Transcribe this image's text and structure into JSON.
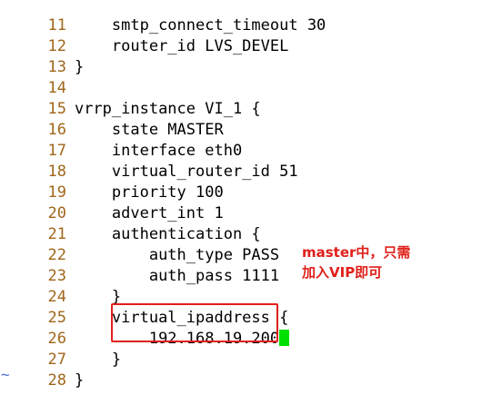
{
  "editor": {
    "lines": [
      {
        "num": "11",
        "text": "    smtp_connect_timeout 30"
      },
      {
        "num": "12",
        "text": "    router_id LVS_DEVEL"
      },
      {
        "num": "13",
        "text": "}"
      },
      {
        "num": "14",
        "text": ""
      },
      {
        "num": "15",
        "text": "vrrp_instance VI_1 {"
      },
      {
        "num": "16",
        "text": "    state MASTER"
      },
      {
        "num": "17",
        "text": "    interface eth0"
      },
      {
        "num": "18",
        "text": "    virtual_router_id 51"
      },
      {
        "num": "19",
        "text": "    priority 100"
      },
      {
        "num": "20",
        "text": "    advert_int 1"
      },
      {
        "num": "21",
        "text": "    authentication {"
      },
      {
        "num": "22",
        "text": "        auth_type PASS"
      },
      {
        "num": "23",
        "text": "        auth_pass 1111"
      },
      {
        "num": "24",
        "text": "    }"
      },
      {
        "num": "25",
        "text": "    virtual_ipaddress {"
      },
      {
        "num": "26",
        "text": "        192.168.19.200"
      },
      {
        "num": "27",
        "text": "    }"
      },
      {
        "num": "28",
        "text": "}"
      }
    ],
    "empty_line_marker": "~",
    "cursor_line": "26"
  },
  "annotation": {
    "line1": "master中，只需",
    "line2": "加入VIP即可"
  },
  "colors": {
    "line_number": "#a0661a",
    "cursor": "#00e000",
    "annotation": "#e0201a",
    "tilde": "#4a6fd6"
  }
}
